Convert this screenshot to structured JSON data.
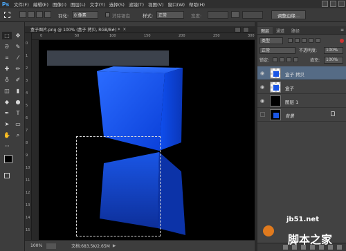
{
  "app": {
    "logo": "Ps"
  },
  "menu": [
    "文件(F)",
    "编辑(E)",
    "图像(I)",
    "图层(L)",
    "文字(Y)",
    "选择(S)",
    "滤镜(T)",
    "视图(V)",
    "窗口(W)",
    "帮助(H)"
  ],
  "options": {
    "feather_label": "羽化:",
    "feather_value": "0 像素",
    "antialias_label": "消除锯齿",
    "style_label": "样式:",
    "style_value": "正常",
    "width_label": "宽度:",
    "refine_button": "调整边缘..."
  },
  "document": {
    "tab_title": "盒子图片.png @ 100% (盒子 拷贝, RGB/8#) *",
    "close": "×"
  },
  "rulers": {
    "horizontal": [
      "0",
      "50",
      "100",
      "150",
      "200",
      "250",
      "300"
    ],
    "vertical": [
      "0",
      "1",
      "2",
      "3",
      "4",
      "5",
      "6",
      "7",
      "8",
      "9",
      "10",
      "11",
      "12",
      "13",
      "14",
      "15"
    ]
  },
  "status": {
    "zoom": "100%",
    "doc_info": "文档:683.5K/2.65M",
    "arrow": "▶"
  },
  "panel": {
    "tabs": [
      "图层",
      "通道",
      "路径"
    ],
    "menu": "≡",
    "filter_kind": "类型",
    "blend_mode": "正常",
    "opacity_label": "不透明度:",
    "opacity_value": "100%",
    "lock_label": "锁定:",
    "fill_label": "填充:",
    "fill_value": "100%"
  },
  "layers": [
    {
      "name": "盒子 拷贝",
      "visible": true,
      "selected": true
    },
    {
      "name": "盒子",
      "visible": true,
      "selected": false
    },
    {
      "name": "图层 1",
      "visible": true,
      "selected": false
    },
    {
      "name": "背景",
      "visible": false,
      "selected": false
    }
  ],
  "watermarks": {
    "site": "jb51.net",
    "brand": "脚本之家"
  },
  "colors": {
    "cube_blue": "#1a56e6",
    "canvas_bg": "#000000",
    "banner": "#3c424c",
    "selected_layer": "#556b85"
  }
}
